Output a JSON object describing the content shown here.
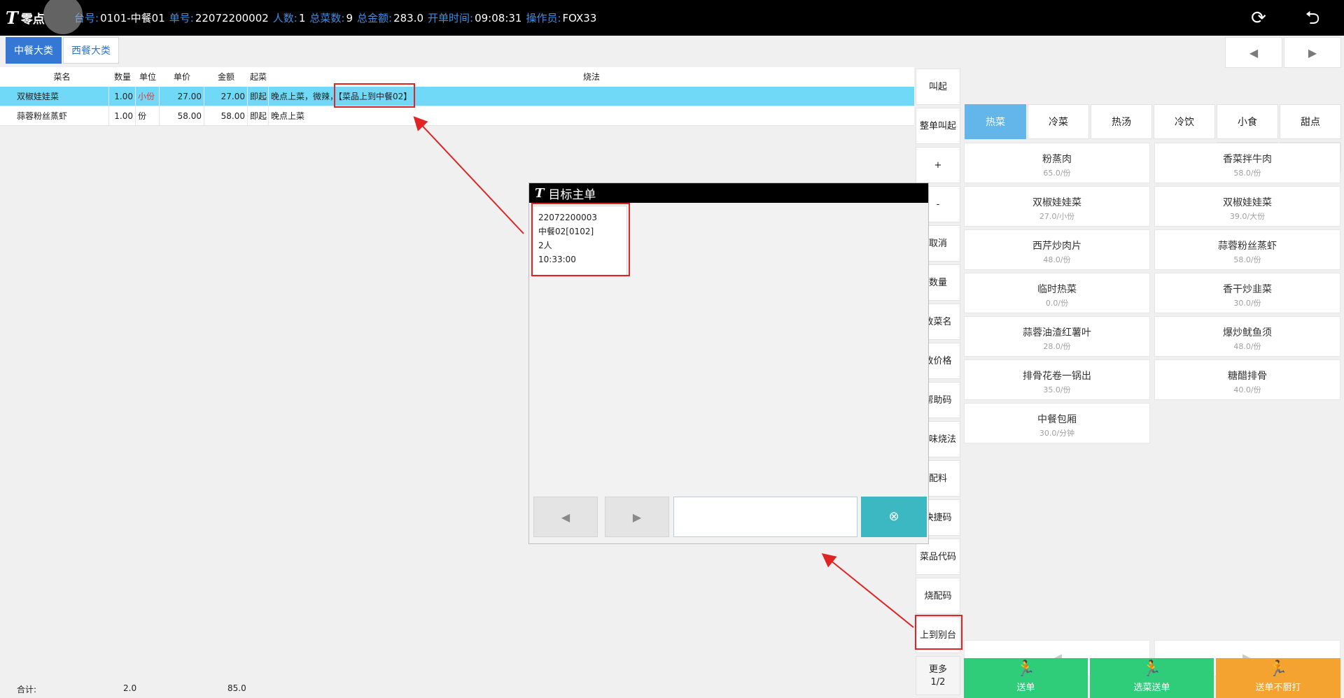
{
  "header": {
    "logo_mark": "T",
    "logo_name": "零点",
    "table_label": "台号:",
    "table_value": "0101-中餐01",
    "order_label": "单号:",
    "order_value": "22072200002",
    "people_label": "人数:",
    "people_value": "1",
    "dishes_label": "总菜数:",
    "dishes_value": "9",
    "amount_label": "总金额:",
    "amount_value": "283.0",
    "open_label": "开单时间:",
    "open_value": "09:08:31",
    "operator_label": "操作员:",
    "operator_value": "FOX33"
  },
  "categories": [
    "中餐大类",
    "西餐大类"
  ],
  "columns": {
    "name": "菜名",
    "qty": "数量",
    "unit": "单位",
    "price": "单价",
    "amount": "金额",
    "start": "起菜",
    "method": "烧法"
  },
  "rows": [
    {
      "name": "双椒娃娃菜",
      "qty": "1.00",
      "unit": "小份",
      "price": "27.00",
      "amount": "27.00",
      "start": "即起",
      "method": "晚点上菜，微辣，【菜品上到中餐02】"
    },
    {
      "name": "蒜蓉粉丝蒸虾",
      "qty": "1.00",
      "unit": "份",
      "price": "58.00",
      "amount": "58.00",
      "start": "即起",
      "method": "晚点上菜"
    }
  ],
  "totals": {
    "label": "合计:",
    "qty": "2.0",
    "amount": "85.0"
  },
  "functions": {
    "call": "叫起",
    "call_all": "整单叫起",
    "plus": "+",
    "minus": "-",
    "cancel": "取消",
    "qty": "数量",
    "rename": "改菜名",
    "reprice": "改价格",
    "help_code": "帮助码",
    "taste": "口味烧法",
    "ingredients": "配料",
    "shortcut": "快捷码",
    "code": "菜品代码",
    "method_code": "烧配码",
    "to_other_table": "上到别台",
    "more": "更多",
    "more_page": "1/2"
  },
  "subcategories": [
    "热菜",
    "冷菜",
    "热汤",
    "冷饮",
    "小食",
    "甜点"
  ],
  "dishes": [
    {
      "name": "粉蒸肉",
      "price": "65.0/份"
    },
    {
      "name": "香菜拌牛肉",
      "price": "58.0/份"
    },
    {
      "name": "双椒娃娃菜",
      "price": "27.0/小份"
    },
    {
      "name": "双椒娃娃菜",
      "price": "39.0/大份"
    },
    {
      "name": "西芹炒肉片",
      "price": "48.0/份"
    },
    {
      "name": "蒜蓉粉丝蒸虾",
      "price": "58.0/份"
    },
    {
      "name": "临时热菜",
      "price": "0.0/份"
    },
    {
      "name": "香干炒韭菜",
      "price": "30.0/份"
    },
    {
      "name": "蒜蓉油渣红薯叶",
      "price": "28.0/份"
    },
    {
      "name": "爆炒鱿鱼须",
      "price": "48.0/份"
    },
    {
      "name": "排骨花卷一锅出",
      "price": "35.0/份"
    },
    {
      "name": "糖醋排骨",
      "price": "40.0/份"
    },
    {
      "name": "中餐包厢",
      "price": "30.0/分钟"
    }
  ],
  "actions": {
    "send": "送单",
    "select_send": "选菜送单",
    "send_no_print": "送单不厨打"
  },
  "action_colors": {
    "green": "#2fcc7a",
    "orange": "#f5a330"
  },
  "dialog": {
    "title": "目标主单",
    "card": {
      "order_no": "22072200003",
      "table": "中餐02[0102]",
      "people": "2人",
      "time": "10:33:00"
    }
  },
  "icons": {
    "refresh": "refresh-icon",
    "back": "back-icon",
    "prev": "chevron-left-icon",
    "next": "chevron-right-icon",
    "clear": "clear-icon",
    "runner": "runner-icon"
  }
}
